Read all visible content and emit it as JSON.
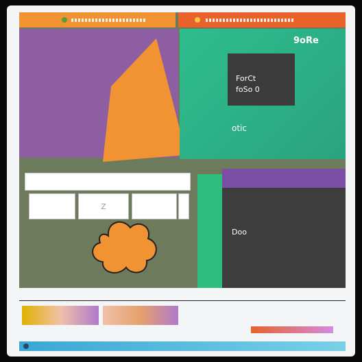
{
  "labels": {
    "top_right_code": "9oRe",
    "card_line1": "ForCt",
    "card_line2": "foSo 0",
    "teal_label": "otic",
    "dark_label": "Doo",
    "tile_2": "Z"
  },
  "colors": {
    "accent_orange": "#f29333",
    "accent_purple": "#8d5fa2",
    "accent_teal": "#2fbd8d",
    "accent_dark": "#3d3d3d"
  },
  "icons": {
    "shape": "cloud-icon"
  }
}
